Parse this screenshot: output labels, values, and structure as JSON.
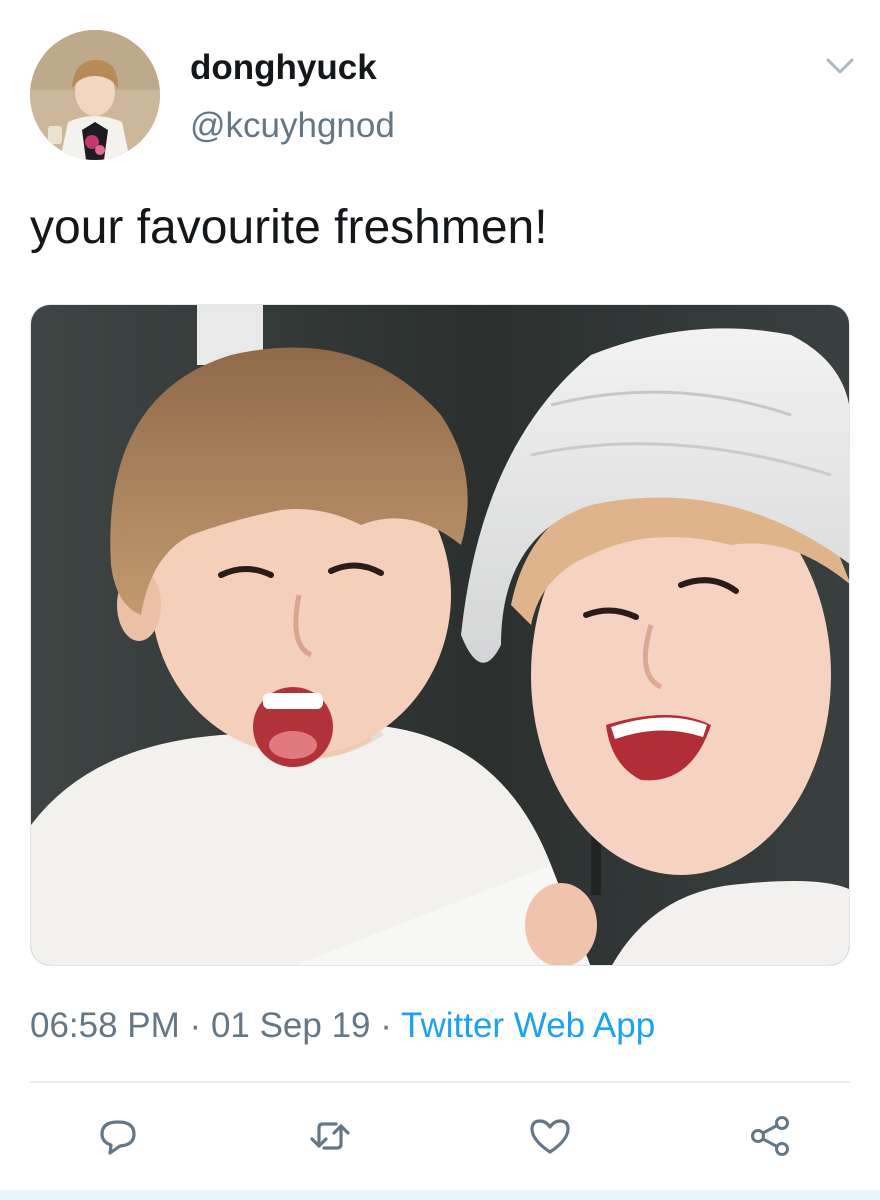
{
  "tweet": {
    "display_name": "donghyuck",
    "handle": "@kcuyhgnod",
    "text": "your favourite freshmen!",
    "time": "06:58 PM",
    "date": "01 Sep 19",
    "separator": "·",
    "source": "Twitter Web App"
  },
  "icons": {
    "caret": "chevron-down-icon",
    "reply": "reply-icon",
    "retweet": "retweet-icon",
    "like": "heart-icon",
    "share": "share-icon"
  },
  "colors": {
    "text": "#14171a",
    "secondary": "#657786",
    "link": "#1da1f2",
    "divider": "#e6ecf0"
  }
}
